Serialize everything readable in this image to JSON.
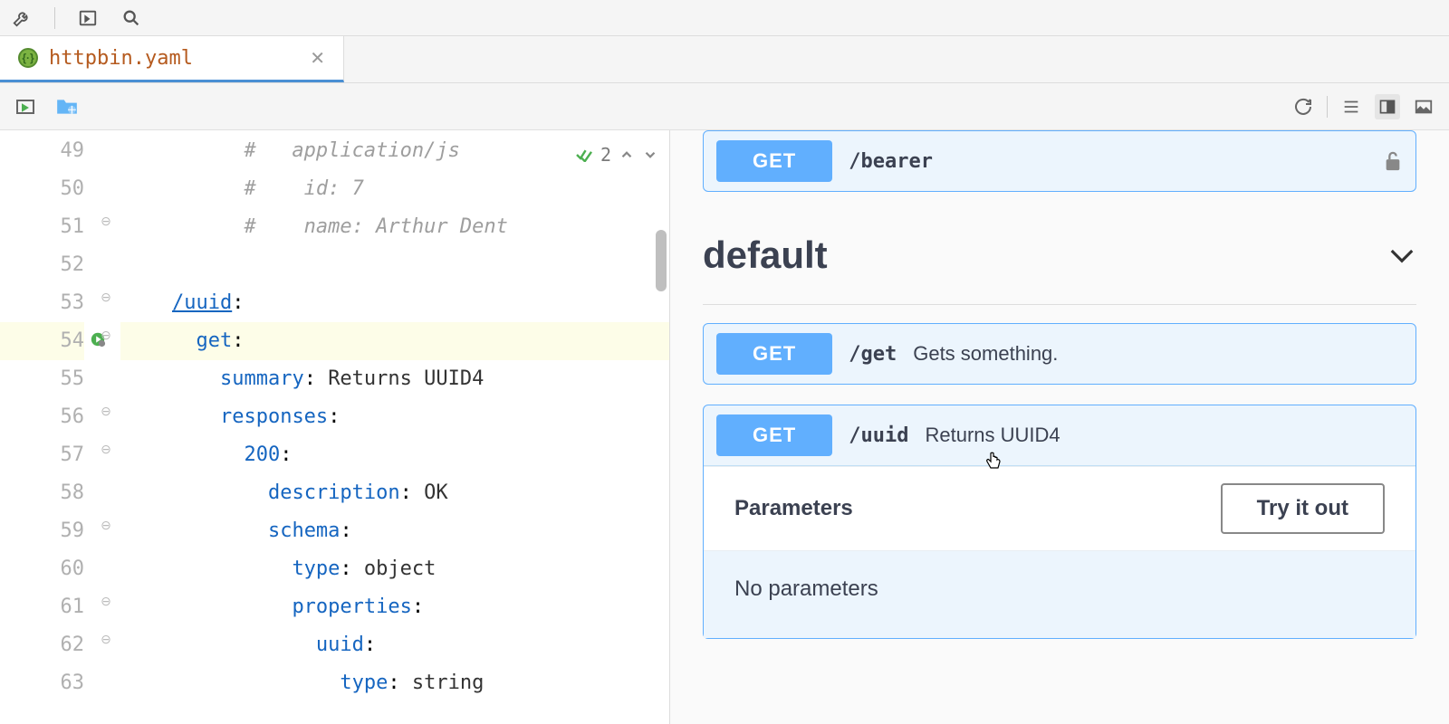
{
  "tab": {
    "label": "httpbin.yaml"
  },
  "inspection": {
    "count": "2"
  },
  "editor": {
    "lines": [
      {
        "num": "49",
        "indent": "          ",
        "comment": "#   application/js"
      },
      {
        "num": "50",
        "indent": "          ",
        "comment": "#    id: 7"
      },
      {
        "num": "51",
        "indent": "          ",
        "comment": "#    name: Arthur Dent"
      },
      {
        "num": "52",
        "indent": "",
        "text": ""
      },
      {
        "num": "53",
        "indent": "    ",
        "path": "/uuid",
        "colon": ":"
      },
      {
        "num": "54",
        "indent": "      ",
        "key": "get",
        "colon": ":",
        "hl": true
      },
      {
        "num": "55",
        "indent": "        ",
        "key": "summary",
        "colon": ": ",
        "val": "Returns UUID4"
      },
      {
        "num": "56",
        "indent": "        ",
        "key": "responses",
        "colon": ":"
      },
      {
        "num": "57",
        "indent": "          ",
        "key": "200",
        "colon": ":"
      },
      {
        "num": "58",
        "indent": "            ",
        "key": "description",
        "colon": ": ",
        "val": "OK"
      },
      {
        "num": "59",
        "indent": "            ",
        "key": "schema",
        "colon": ":"
      },
      {
        "num": "60",
        "indent": "              ",
        "key": "type",
        "colon": ": ",
        "val": "object"
      },
      {
        "num": "61",
        "indent": "              ",
        "key": "properties",
        "colon": ":"
      },
      {
        "num": "62",
        "indent": "                ",
        "key": "uuid",
        "colon": ":"
      },
      {
        "num": "63",
        "indent": "                  ",
        "key": "type",
        "colon": ": ",
        "val": "string"
      }
    ]
  },
  "preview": {
    "bearer": {
      "method": "GET",
      "path": "/bearer"
    },
    "section": "default",
    "get_ep": {
      "method": "GET",
      "path": "/get",
      "desc": "Gets something."
    },
    "uuid_ep": {
      "method": "GET",
      "path": "/uuid",
      "desc": "Returns UUID4"
    },
    "params_label": "Parameters",
    "try_label": "Try it out",
    "no_params": "No parameters"
  }
}
